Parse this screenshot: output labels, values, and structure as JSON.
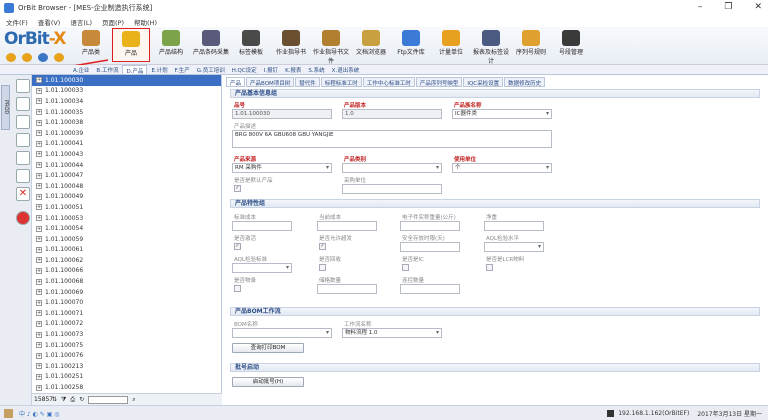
{
  "window": {
    "title": "OrBit Browser - [MES-企业制造执行系统]",
    "min": "–",
    "max": "❐",
    "close": "✕"
  },
  "menu": [
    "文件(F)",
    "查看(V)",
    "语言(L)",
    "页面(P)",
    "帮助(H)"
  ],
  "logo": {
    "text1": "OrBit",
    "text2": "-X"
  },
  "toolbar": [
    {
      "label": "产品类",
      "color": "#c78a3a"
    },
    {
      "label": "产品",
      "color": "#e9b11a",
      "selected": true
    },
    {
      "label": "产品结构",
      "color": "#7aa34a"
    },
    {
      "label": "产品条码采集",
      "color": "#5a5a7a"
    },
    {
      "label": "标签模板",
      "color": "#4a4a4a"
    },
    {
      "label": "作业指导书",
      "color": "#6a5030"
    },
    {
      "label": "作业指导书文件",
      "color": "#b08030"
    },
    {
      "label": "文档浏览器",
      "color": "#c8a040"
    },
    {
      "label": "Ftp文件库",
      "color": "#3b7ad6"
    },
    {
      "label": "计量单位",
      "color": "#e8a020"
    },
    {
      "label": "报表及标签设计",
      "color": "#4a5a80"
    },
    {
      "label": "序列号规则",
      "color": "#e0a030"
    },
    {
      "label": "号段管理",
      "color": "#3a3a3a"
    }
  ],
  "module_tabs": [
    "A.企业",
    "B.工作流",
    "D.产品",
    "E.计划",
    "F.生产",
    "G.员工培训",
    "H.QC设定",
    "I.报钉",
    "K.报表",
    "S.系统",
    "X.退出系统"
  ],
  "module_active": "D.产品",
  "left_vtab": "PROD",
  "tree": {
    "selected": "1.01.100030",
    "items": [
      "1.01.100030",
      "1.01.100033",
      "1.01.100034",
      "1.01.100035",
      "1.01.100038",
      "1.01.100039",
      "1.01.100041",
      "1.01.100043",
      "1.01.100044",
      "1.01.100047",
      "1.01.100048",
      "1.01.100049",
      "1.01.100051",
      "1.01.100053",
      "1.01.100054",
      "1.01.100059",
      "1.01.100061",
      "1.01.100062",
      "1.01.100066",
      "1.01.100068",
      "1.01.100069",
      "1.01.100070",
      "1.01.100071",
      "1.01.100072",
      "1.01.100073",
      "1.01.100075",
      "1.01.100076",
      "1.01.100213",
      "1.01.100251",
      "1.01.100258"
    ],
    "count": "15857"
  },
  "subtabs": [
    "产品",
    "产品BOM项目树",
    "替代件",
    "标程标准工时",
    "工作中心标准工时",
    "产品序列号映型",
    "IQC采检设置",
    "数据修改历史"
  ],
  "sec1": "产品基本信息组",
  "sec2": "产品特性组",
  "sec3": "产品BOM工作流",
  "sec4": "批号启动",
  "fields": {
    "code_l": "品号",
    "code_v": "1.01.100030",
    "ver_l": "产品版本",
    "ver_v": "1.0",
    "cat_l": "产品族名称",
    "cat_v": "IC器件类",
    "desc_l": "产品描述",
    "desc_v": "BRG 800V 6A GBU608 GBU YANGJIE",
    "src_l": "产品来源",
    "src_v": "RM 采购件",
    "type_l": "产品类别",
    "unit_l": "使用单位",
    "unit_v": "个",
    "def_l": "是否是默认产品",
    "buy_l": "采购单位",
    "cost_l": "标准成本",
    "cur_l": "当前成本",
    "esd_l": "电子件实称重量(公斤)",
    "net_l": "净重",
    "act_l": "是否激活",
    "mix_l": "是否允许超发",
    "safe_l": "安全存放时限(天)",
    "aql_l": "AQL检验水平",
    "aqls_l": "AQL检验标准",
    "reinsp_l": "是否回收",
    "ic_l": "是否是IC",
    "lcr_l": "是否是LCR物料",
    "pack_l": "是否物录",
    "lot_l": "储格数量",
    "cont_l": "连控数量",
    "bom_l": "BOM名称",
    "wf_l": "工作流名称",
    "wf_v": "物料流程 1.0",
    "bom_btn": "查询打印BOM",
    "batch_btn": "启动批号(H)"
  },
  "status": {
    "ip": "192.168.1.162(OrBitEF)",
    "date": "2017年3月13日 星期一"
  }
}
